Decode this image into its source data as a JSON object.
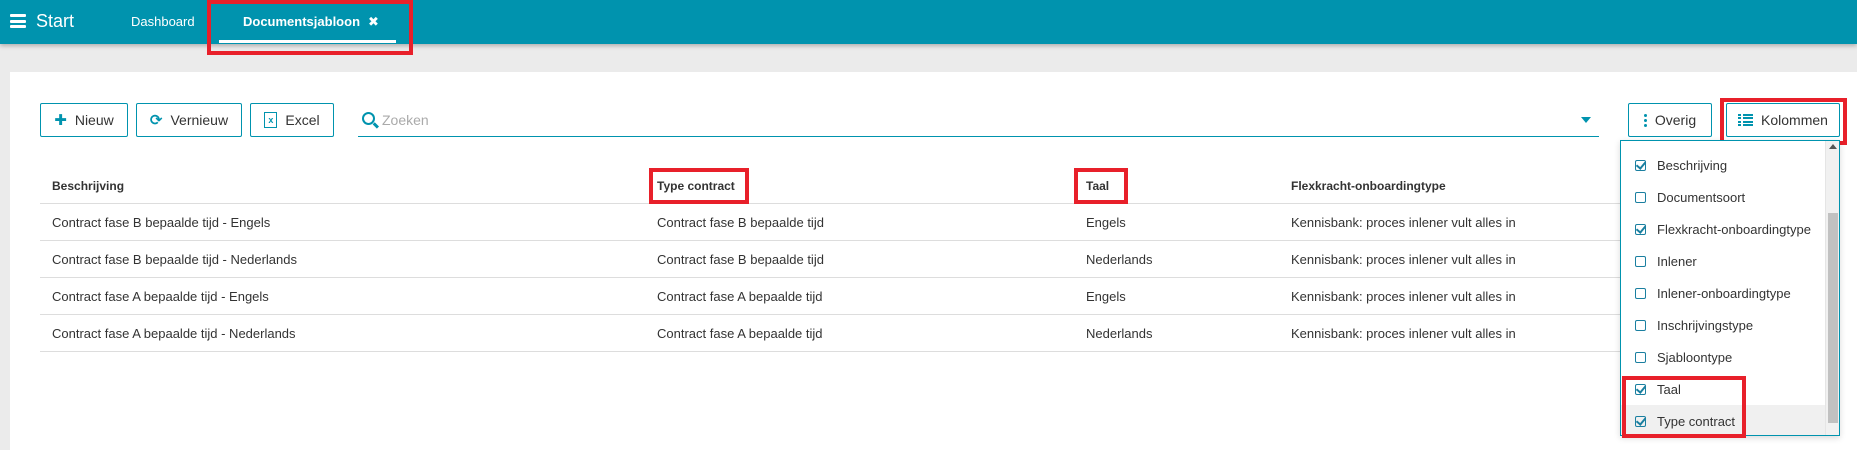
{
  "topbar": {
    "start_label": "Start",
    "tabs": [
      {
        "label": "Dashboard"
      },
      {
        "label": "Documentsjabloon",
        "close": "✖"
      }
    ]
  },
  "toolbar": {
    "new_label": "Nieuw",
    "refresh_label": "Vernieuw",
    "excel_label": "Excel",
    "search_placeholder": "Zoeken",
    "other_label": "Overig",
    "columns_label": "Kolommen"
  },
  "table": {
    "headers": [
      "Beschrijving",
      "Type contract",
      "Taal",
      "Flexkracht-onboardingtype"
    ],
    "rows": [
      [
        "Contract fase B bepaalde tijd - Engels",
        "Contract fase B bepaalde tijd",
        "Engels",
        "Kennisbank: proces inlener vult alles in"
      ],
      [
        "Contract fase B bepaalde tijd - Nederlands",
        "Contract fase B bepaalde tijd",
        "Nederlands",
        "Kennisbank: proces inlener vult alles in"
      ],
      [
        "Contract fase A bepaalde tijd - Engels",
        "Contract fase A bepaalde tijd",
        "Engels",
        "Kennisbank: proces inlener vult alles in"
      ],
      [
        "Contract fase A bepaalde tijd - Nederlands",
        "Contract fase A bepaalde tijd",
        "Nederlands",
        "Kennisbank: proces inlener vult alles in"
      ]
    ]
  },
  "column_chooser": {
    "items": [
      {
        "label": "Beschrijving",
        "checked": true
      },
      {
        "label": "Documentsoort",
        "checked": false
      },
      {
        "label": "Flexkracht-onboardingtype",
        "checked": true
      },
      {
        "label": "Inlener",
        "checked": false
      },
      {
        "label": "Inlener-onboardingtype",
        "checked": false
      },
      {
        "label": "Inschrijvingstype",
        "checked": false
      },
      {
        "label": "Sjabloontype",
        "checked": false
      },
      {
        "label": "Taal",
        "checked": true
      },
      {
        "label": "Type contract",
        "checked": true
      }
    ]
  },
  "colors": {
    "brand": "#0093ae",
    "highlight": "#e8202a"
  }
}
